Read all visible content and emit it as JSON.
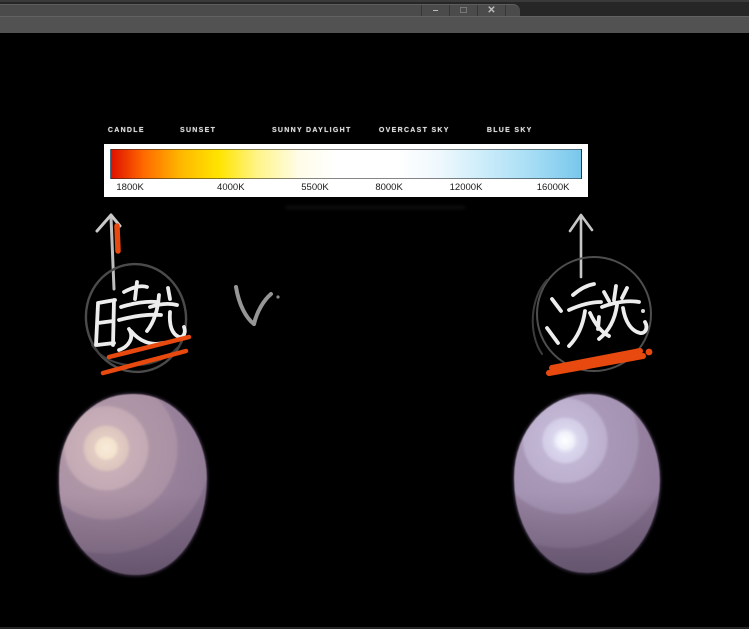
{
  "window": {
    "title": "",
    "controls": {
      "minimize": "–",
      "maximize": "□",
      "close": "✕"
    }
  },
  "chart_data": {
    "type": "color-scale",
    "categories": [
      "CANDLE",
      "SUNSET",
      "SUNNY DAYLIGHT",
      "OVERCAST SKY",
      "BLUE SKY"
    ],
    "category_positions_pct": [
      0.8,
      15.7,
      34.7,
      56.8,
      79.1
    ],
    "ticks": [
      "1800K",
      "4000K",
      "5500K",
      "8000K",
      "12000K",
      "16000K"
    ],
    "tick_values_kelvin": [
      1800,
      4000,
      5500,
      8000,
      12000,
      16000
    ],
    "tick_positions_pct": [
      5.4,
      26.2,
      43.6,
      58.9,
      74.8,
      92.8
    ],
    "unit": "K",
    "gradient_stops": [
      {
        "color": "#df1000",
        "pos": 0
      },
      {
        "color": "#ff6a00",
        "pos": 7
      },
      {
        "color": "#ffb800",
        "pos": 15
      },
      {
        "color": "#ffe400",
        "pos": 23
      },
      {
        "color": "#fff486",
        "pos": 31
      },
      {
        "color": "#fffce8",
        "pos": 40
      },
      {
        "color": "#ffffff",
        "pos": 48
      },
      {
        "color": "#ffffff",
        "pos": 61
      },
      {
        "color": "#eef8fd",
        "pos": 70
      },
      {
        "color": "#cdedfa",
        "pos": 79
      },
      {
        "color": "#a8def5",
        "pos": 89
      },
      {
        "color": "#79c7ec",
        "pos": 100
      }
    ]
  },
  "annotations": {
    "warm_light": {
      "text": "暖光"
    },
    "cold_light": {
      "text": "冷光"
    },
    "accent_color": "#e8490f",
    "ink_color": "#ededed"
  },
  "palette": {
    "canvas_bg": "#000000",
    "chrome_bar": "#525252",
    "warm_sphere_body": "#8f7b93",
    "warm_sphere_highlight": "#f8ecd9",
    "cool_sphere_body": "#93809a",
    "cool_sphere_highlight": "#ffffff"
  }
}
